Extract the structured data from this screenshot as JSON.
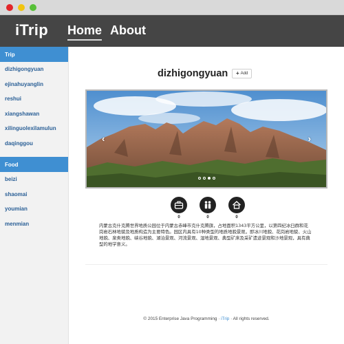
{
  "navbar": {
    "brand": "iTrip",
    "links": [
      "Home",
      "About"
    ]
  },
  "sidebar": {
    "sections": [
      {
        "heading": "Trip",
        "items": [
          "dizhigongyuan",
          "ejinahuyanglin",
          "reshui",
          "xiangshawan",
          "xilinguolexilamulun",
          "daqinggou"
        ]
      },
      {
        "heading": "Food",
        "items": [
          "beizi",
          "shaomai",
          "youmian",
          "menmian"
        ]
      }
    ]
  },
  "main": {
    "title": "dizhigongyuan",
    "add_label": "Add",
    "carousel": {
      "prev_icon": "chevron-left-icon",
      "next_icon": "chevron-right-icon",
      "slide_count": 4,
      "active_index": 2
    },
    "stats": [
      {
        "icon": "suitcase-icon",
        "count": "0"
      },
      {
        "icon": "people-icon",
        "count": "0"
      },
      {
        "icon": "home-icon",
        "count": "0"
      }
    ],
    "description": "内蒙古克什克腾世界地质公园位于内蒙古赤峰市克什克腾旗，占地面积1343平方公里，以第四纪冰臼群和花岗岩石林地貌及地质构造为主要特色。园区内具有10种类型的地质地貌景观，即冰川地貌、花岗岩地貌、火山地貌、泉类地貌、峡谷地貌、湖泊景观、河流景观、湿地景观、典型矿床及采矿遗迹景观和沙地景观，具有典型的地学意义。"
  },
  "footer": {
    "prefix": "© 2015 Enterprise Java Programming · ",
    "brand": "iTrip",
    "suffix": " · All rights reserved."
  },
  "colors": {
    "navbar": "#454545",
    "accent": "#3f8fd2",
    "sidebar_bg": "#f2f2f2",
    "link": "#2a5f96"
  }
}
